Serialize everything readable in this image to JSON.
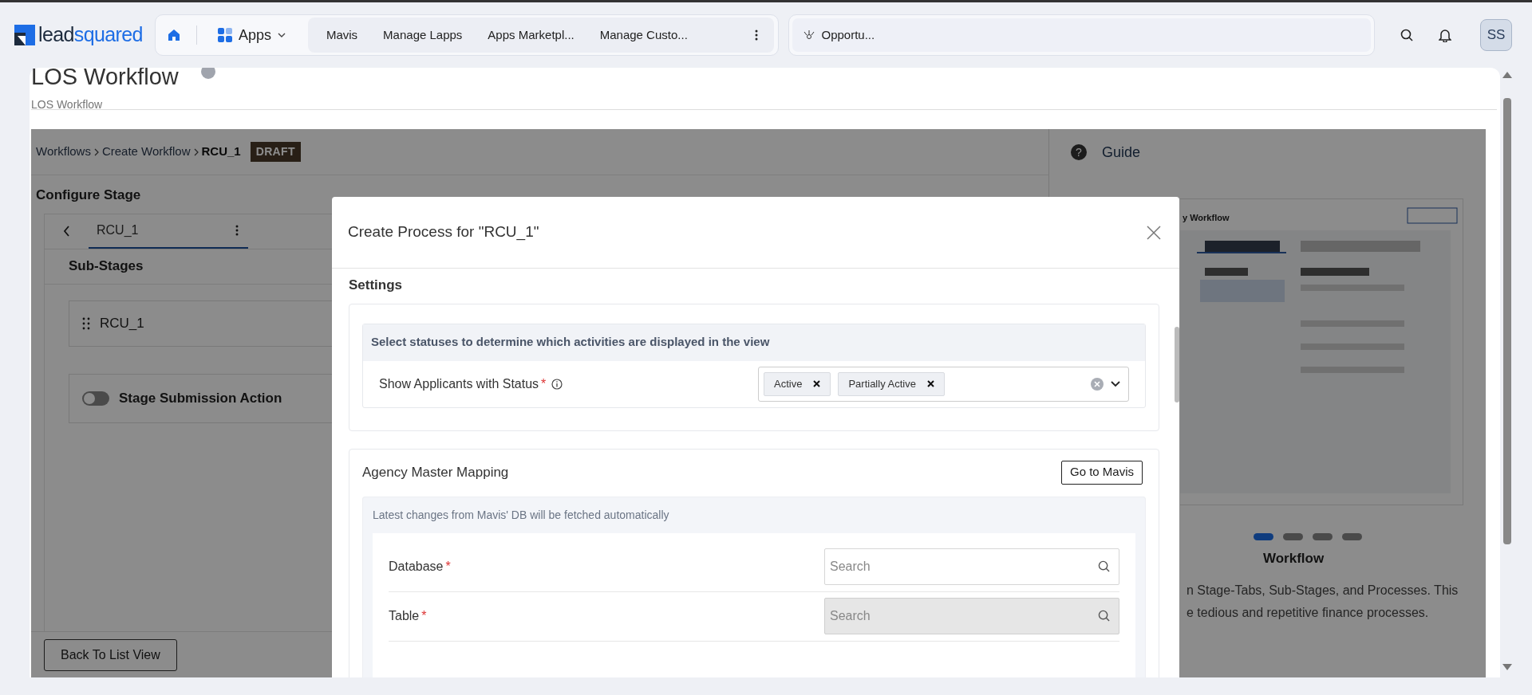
{
  "top_nav": {
    "logo": {
      "part_1": "lead",
      "part_2": "squared"
    },
    "apps_label": "Apps",
    "links": [
      {
        "label": "Mavis"
      },
      {
        "label": "Manage Lapps"
      },
      {
        "label": "Apps Marketpl..."
      },
      {
        "label": "Manage Custo..."
      }
    ],
    "open_tab": "Opportu...",
    "avatar": "SS"
  },
  "page": {
    "title": "LOS Workflow",
    "subtitle": "LOS Workflow"
  },
  "breadcrumb": {
    "items": [
      "Workflows",
      "Create Workflow",
      "RCU_1"
    ],
    "badge": "DRAFT"
  },
  "configure_stage": {
    "heading": "Configure Stage",
    "tabs": [
      {
        "label": "RCU_1",
        "selected": true
      }
    ],
    "sub_stages_heading": "Sub-Stages",
    "sub_stages": [
      {
        "label": "RCU_1"
      }
    ],
    "submission_action": {
      "label": "Stage Submission Action",
      "on": false
    },
    "back_button": "Back To List View"
  },
  "guide": {
    "help_icon": "?",
    "title": "Guide",
    "preview_title": "y Workflow",
    "slides": [
      {
        "selected": true
      },
      {
        "selected": false
      },
      {
        "selected": false
      },
      {
        "selected": false
      }
    ],
    "slide_title": "Workflow",
    "description_lines": [
      "n Stage-Tabs, Sub-Stages, and Processes. This",
      "e tedious and repetitive finance processes."
    ]
  },
  "modal": {
    "title": "Create Process for \"RCU_1\"",
    "settings_heading": "Settings",
    "status_hint": "Select statuses to determine which activities are displayed in the view",
    "status_label": "Show Applicants with Status",
    "status_required_mark": "*",
    "status_chips": [
      {
        "label": "Active"
      },
      {
        "label": "Partially Active"
      }
    ],
    "agency": {
      "title": "Agency Master Mapping",
      "button": "Go to Mavis",
      "note": "Latest changes from Mavis' DB will be fetched automatically",
      "fields": [
        {
          "label": "Database",
          "required_mark": "*",
          "placeholder": "Search",
          "disabled": false
        },
        {
          "label": "Table",
          "required_mark": "*",
          "placeholder": "Search",
          "disabled": true
        }
      ]
    }
  }
}
